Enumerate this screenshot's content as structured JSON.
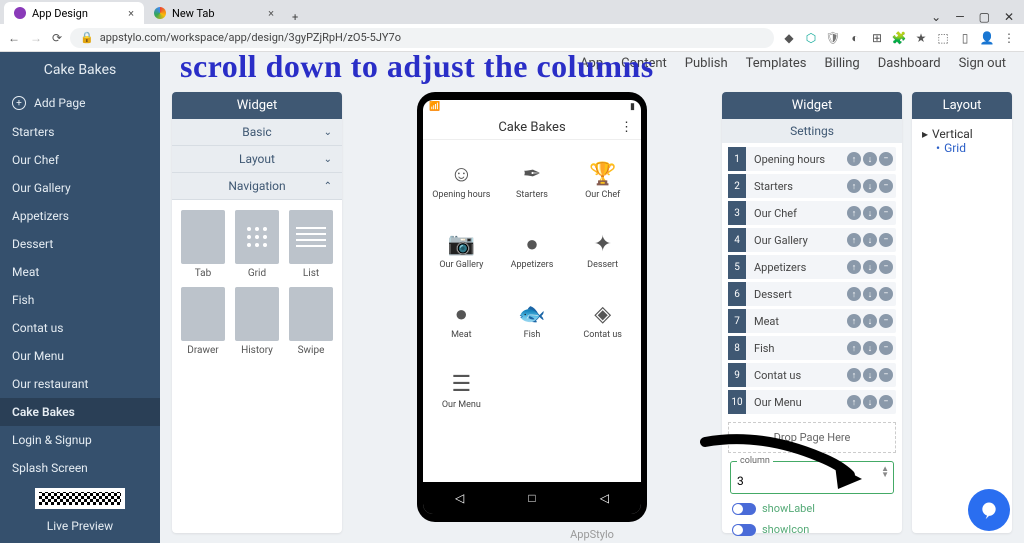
{
  "browser": {
    "tab1": "App Design",
    "tab2": "New Tab",
    "url": "appstylo.com/workspace/app/design/3gyPZjRpH/zO5-5JY7o"
  },
  "overlay": "scroll down to adjust the columns",
  "topnav": {
    "apps": "App",
    "content": "Content",
    "publish": "Publish",
    "templates": "Templates",
    "billing": "Billing",
    "dashboard": "Dashboard",
    "signout": "Sign out"
  },
  "sidebar": {
    "title": "Cake Bakes",
    "add": "Add Page",
    "items": [
      "Starters",
      "Our Chef",
      "Our Gallery",
      "Appetizers",
      "Dessert",
      "Meat",
      "Fish",
      "Contat us",
      "Our Menu",
      "Our restaurant",
      "Cake Bakes",
      "Login & Signup",
      "Splash Screen"
    ],
    "active_index": 10,
    "preview": "Live Preview"
  },
  "widgetLeft": {
    "header": "Widget",
    "acc": [
      "Basic",
      "Layout",
      "Navigation"
    ],
    "open_index": 2,
    "templates": [
      "Tab",
      "Grid",
      "List",
      "Drawer",
      "History",
      "Swipe"
    ]
  },
  "phone": {
    "title": "Cake Bakes",
    "brand": "AppStylo",
    "items": [
      "Opening hours",
      "Starters",
      "Our Chef",
      "Our Gallery",
      "Appetizers",
      "Dessert",
      "Meat",
      "Fish",
      "Contat us",
      "Our Menu"
    ]
  },
  "widgetRight": {
    "header": "Widget",
    "sub": "Settings",
    "rows": [
      "Opening hours",
      "Starters",
      "Our Chef",
      "Our Gallery",
      "Appetizers",
      "Dessert",
      "Meat",
      "Fish",
      "Contat us",
      "Our Menu"
    ],
    "drop": "Drop Page Here",
    "column_label": "column",
    "column_value": "3",
    "show_label": "showLabel",
    "show_icon": "showIcon"
  },
  "layoutPanel": {
    "header": "Layout",
    "vertical": "Vertical",
    "grid": "Grid"
  }
}
